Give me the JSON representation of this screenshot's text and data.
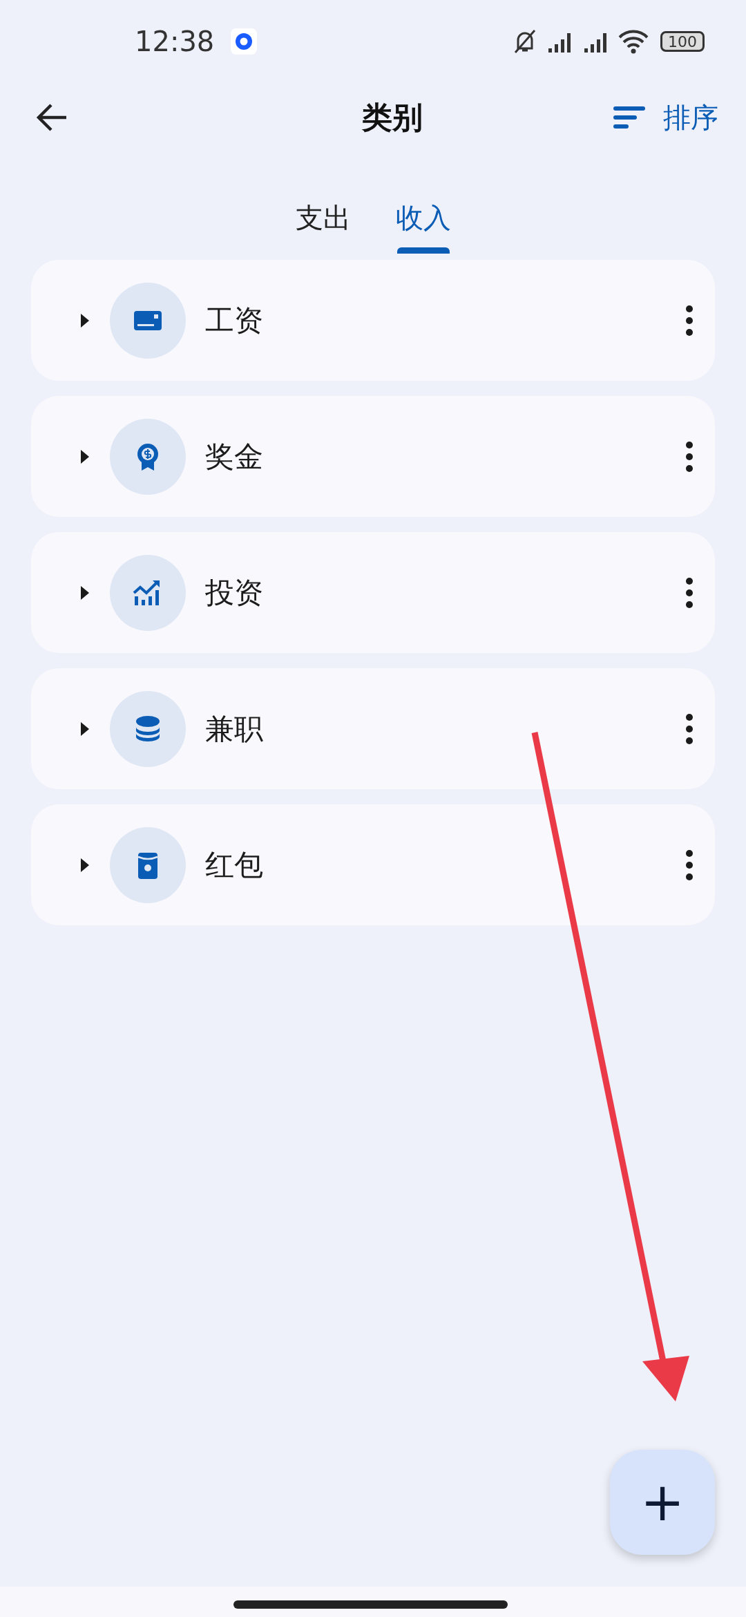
{
  "status_bar": {
    "time": "12:38",
    "battery": "100"
  },
  "header": {
    "title": "类别",
    "sort_label": "排序"
  },
  "tabs": [
    {
      "label": "支出",
      "selected": false
    },
    {
      "label": "收入",
      "selected": true
    }
  ],
  "categories": [
    {
      "name": "工资",
      "expanded": false
    },
    {
      "name": "奖金",
      "expanded": false
    },
    {
      "name": "投资",
      "expanded": false
    },
    {
      "name": "兼职",
      "expanded": false
    },
    {
      "name": "红包",
      "expanded": false
    }
  ],
  "fab": {
    "label": "+"
  }
}
